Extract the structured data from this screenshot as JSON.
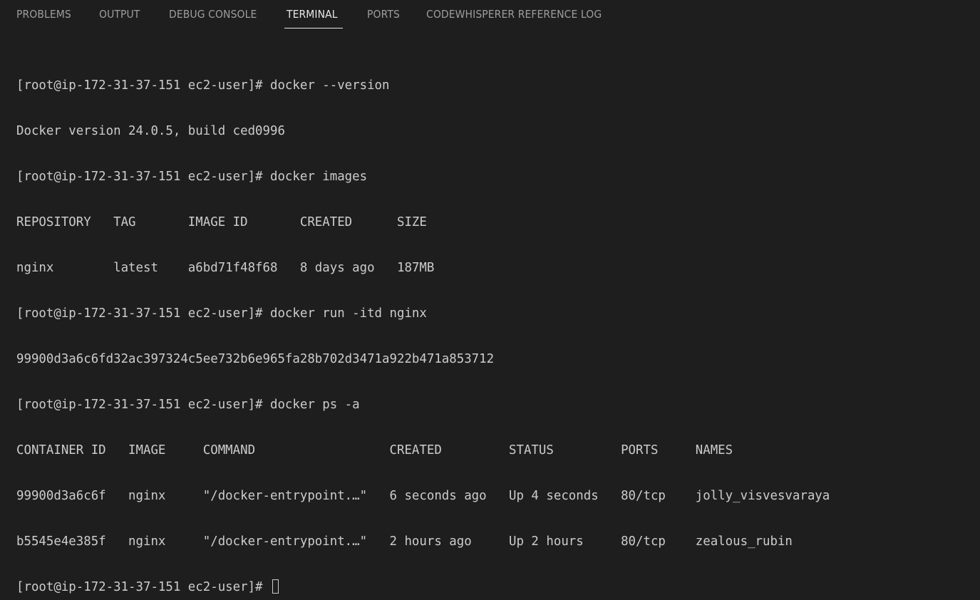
{
  "tabs": [
    {
      "label": "PROBLEMS",
      "active": false
    },
    {
      "label": "OUTPUT",
      "active": false
    },
    {
      "label": "DEBUG CONSOLE",
      "active": false
    },
    {
      "label": "TERMINAL",
      "active": true
    },
    {
      "label": "PORTS",
      "active": false
    },
    {
      "label": "CODEWHISPERER REFERENCE LOG",
      "active": false
    }
  ],
  "terminal": {
    "lines": [
      "[root@ip-172-31-37-151 ec2-user]# docker --version",
      "Docker version 24.0.5, build ced0996",
      "[root@ip-172-31-37-151 ec2-user]# docker images",
      "REPOSITORY   TAG       IMAGE ID       CREATED      SIZE",
      "nginx        latest    a6bd71f48f68   8 days ago   187MB",
      "[root@ip-172-31-37-151 ec2-user]# docker run -itd nginx",
      "99900d3a6c6fd32ac397324c5ee732b6e965fa28b702d3471a922b471a853712",
      "[root@ip-172-31-37-151 ec2-user]# docker ps -a",
      "CONTAINER ID   IMAGE     COMMAND                  CREATED         STATUS         PORTS     NAMES",
      "99900d3a6c6f   nginx     \"/docker-entrypoint.…\"   6 seconds ago   Up 4 seconds   80/tcp    jolly_visvesvaraya",
      "b5545e4e385f   nginx     \"/docker-entrypoint.…\"   2 hours ago     Up 2 hours     80/tcp    zealous_rubin"
    ],
    "prompt": "[root@ip-172-31-37-151 ec2-user]# "
  },
  "colors": {
    "background": "#1e1e1e",
    "text": "#cccccc",
    "tab_inactive": "#9d9d9d",
    "tab_active": "#e7e7e7"
  }
}
